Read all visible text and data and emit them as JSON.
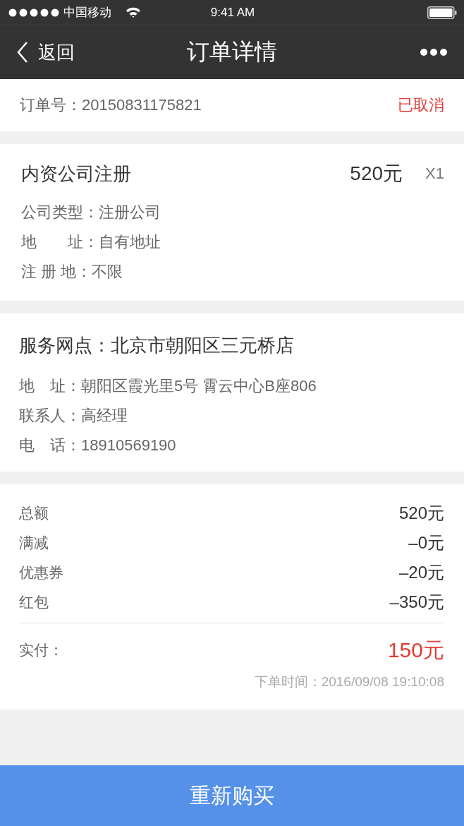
{
  "status_bar": {
    "carrier": "中国移动",
    "time": "9:41 AM"
  },
  "nav": {
    "back": "返回",
    "title": "订单详情"
  },
  "order": {
    "label": "订单号：20150831175821",
    "status": "已取消"
  },
  "product": {
    "name": "内资公司注册",
    "price": "520元",
    "quantity": "X1",
    "fields": [
      {
        "label": "公司类型：",
        "value": "注册公司"
      },
      {
        "label": "地　　址：",
        "value": "自有地址"
      },
      {
        "label": "注 册 地：",
        "value": "不限"
      }
    ]
  },
  "service": {
    "title": "服务网点：北京市朝阳区三元桥店",
    "fields": [
      {
        "label": "地　址：",
        "value": "朝阳区霞光里5号 霄云中心B座806"
      },
      {
        "label": "联系人：",
        "value": "高经理"
      },
      {
        "label": "电　话：",
        "value": "18910569190"
      }
    ]
  },
  "totals": {
    "rows": [
      {
        "label": "总额",
        "value": "520元"
      },
      {
        "label": "满减",
        "value": "–0元"
      },
      {
        "label": "优惠券",
        "value": "–20元"
      },
      {
        "label": "红包",
        "value": "–350元"
      }
    ],
    "paid_label": "实付：",
    "paid_value": "150元",
    "order_time": "下单时间：2016/09/08 19:10:08"
  },
  "action": "重新购买"
}
